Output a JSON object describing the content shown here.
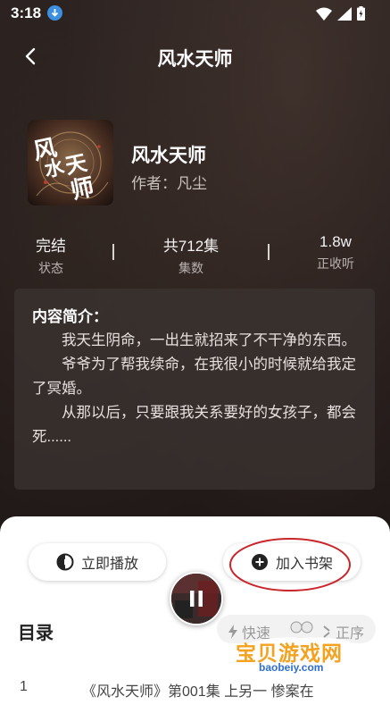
{
  "status_bar": {
    "time": "3:18"
  },
  "header": {
    "title": "风水天师"
  },
  "book": {
    "cover_text": "风水天师",
    "title": "风水天师",
    "author": "作者：凡尘"
  },
  "stats": [
    {
      "value": "完结",
      "label": "状态"
    },
    {
      "value": "共712集",
      "label": "集数"
    },
    {
      "value": "1.8w",
      "label": "正收听"
    }
  ],
  "synopsis": {
    "heading": "内容简介：",
    "paragraphs": [
      "我天生阴命，一出生就招来了不干净的东西。",
      "爷爷为了帮我续命，在我很小的时候就给我定了冥婚。",
      "从那以后，只要跟我关系要好的女孩子，都会死......"
    ]
  },
  "actions": {
    "play_label": "立即播放",
    "add_shelf_label": "加入书架"
  },
  "toc": {
    "title": "目录",
    "fast_label": "快速",
    "order_label": "正序",
    "first_row": {
      "index": "1",
      "title": "《风水天师》第001集 上另一 惨案在"
    }
  },
  "watermark": {
    "text": "宝贝游戏网",
    "url": "baobeiy.com"
  },
  "colors": {
    "circle_annotation": "#c9252b",
    "watermark_orange": "#f4a21f",
    "download_blue": "#3d8fe0"
  }
}
